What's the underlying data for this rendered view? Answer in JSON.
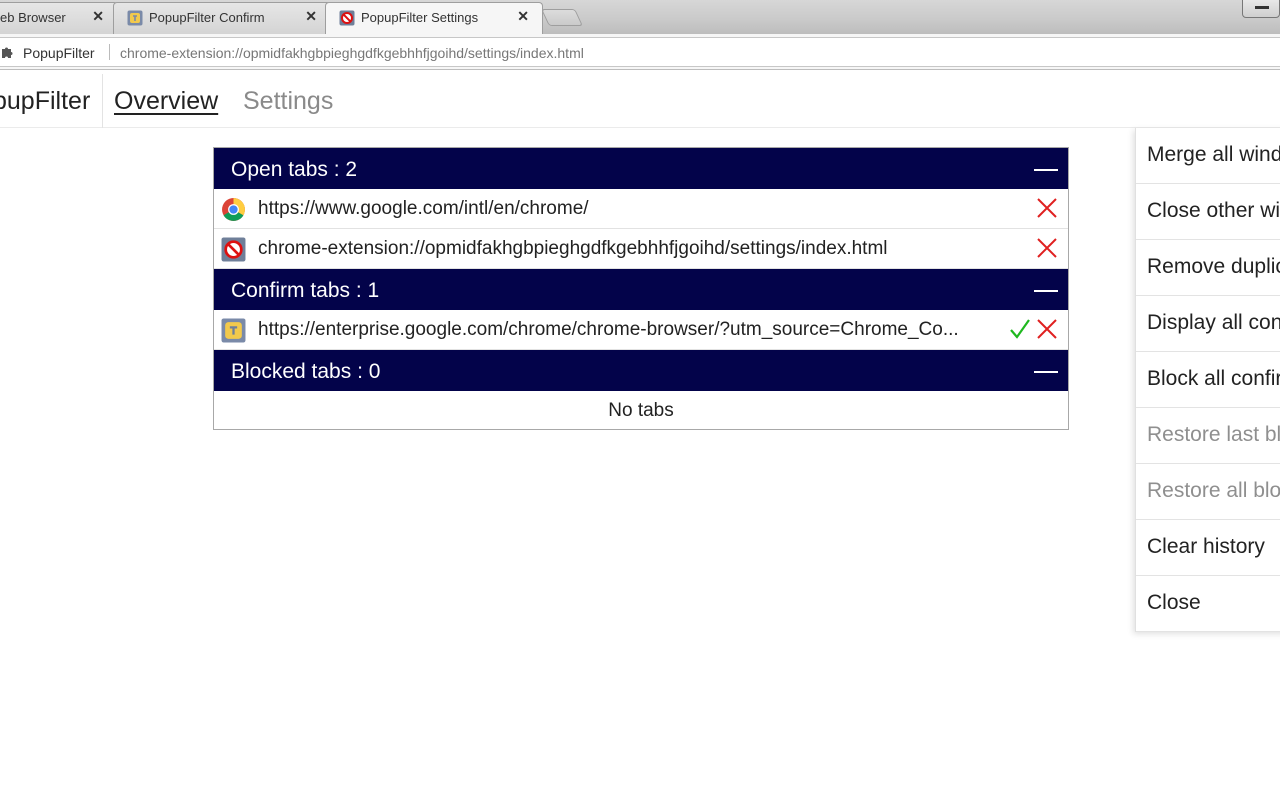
{
  "browser": {
    "tabs": [
      {
        "title": "eb Browser",
        "active": false
      },
      {
        "title": "PopupFilter Confirm",
        "active": false
      },
      {
        "title": "PopupFilter Settings",
        "active": true
      }
    ],
    "close_glyph": "✕",
    "omnibox": {
      "origin": "PopupFilter",
      "url": "chrome-extension://opmidfakhgbpieghgdfkgebhhfjgoihd/settings/index.html"
    }
  },
  "app": {
    "brand": "pupFilter",
    "nav": {
      "overview": "Overview",
      "settings": "Settings"
    },
    "accent_color": "#03034a"
  },
  "sections": {
    "open": {
      "label": "Open tabs : 2",
      "items": [
        {
          "url": "https://www.google.com/intl/en/chrome/",
          "icon": "chrome-icon"
        },
        {
          "url": "chrome-extension://opmidfakhgbpieghgdfkgebhhfjgoihd/settings/index.html",
          "icon": "popupfilter-icon"
        }
      ]
    },
    "confirm": {
      "label": "Confirm tabs : 1",
      "items": [
        {
          "url": "https://enterprise.google.com/chrome/chrome-browser/?utm_source=Chrome_Co...",
          "icon": "enterprise-icon"
        }
      ]
    },
    "blocked": {
      "label": "Blocked tabs : 0",
      "empty": "No tabs"
    }
  },
  "menu": {
    "items": [
      {
        "label": "Merge all windows",
        "enabled": true
      },
      {
        "label": "Close other windows",
        "enabled": true
      },
      {
        "label": "Remove duplicates",
        "enabled": true
      },
      {
        "label": "Display all confirm",
        "enabled": true
      },
      {
        "label": "Block all confirm",
        "enabled": true
      },
      {
        "label": "Restore last blocked",
        "enabled": false
      },
      {
        "label": "Restore all blocked",
        "enabled": false
      },
      {
        "label": "Clear history",
        "enabled": true
      },
      {
        "label": "Close",
        "enabled": true
      }
    ]
  }
}
